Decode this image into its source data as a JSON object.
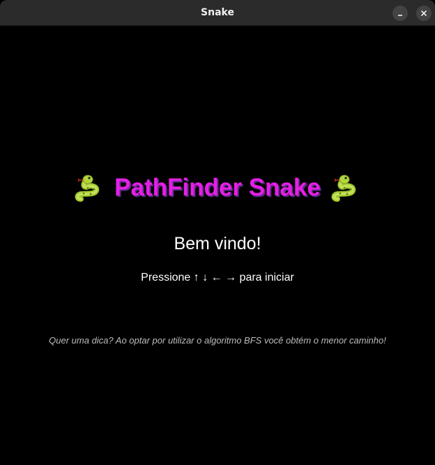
{
  "window": {
    "title": "Snake",
    "minimize_icon": "minimize-icon",
    "close_icon": "close-icon"
  },
  "screen": {
    "heading": "PathFinder Snake",
    "heading_icon": "snake-emoji",
    "welcome": "Bem vindo!",
    "instruction": "Pressione ↑ ↓ ← → para iniciar",
    "tip": "Quer uma dica? Ao optar por utilizar o algoritmo BFS você obtém o menor caminho!"
  },
  "colors": {
    "background": "#000000",
    "titlebar": "#2b2b2b",
    "heading": "#e61ee6",
    "heading_shadow": "#5a2f86",
    "tip": "#bdbdbd"
  }
}
